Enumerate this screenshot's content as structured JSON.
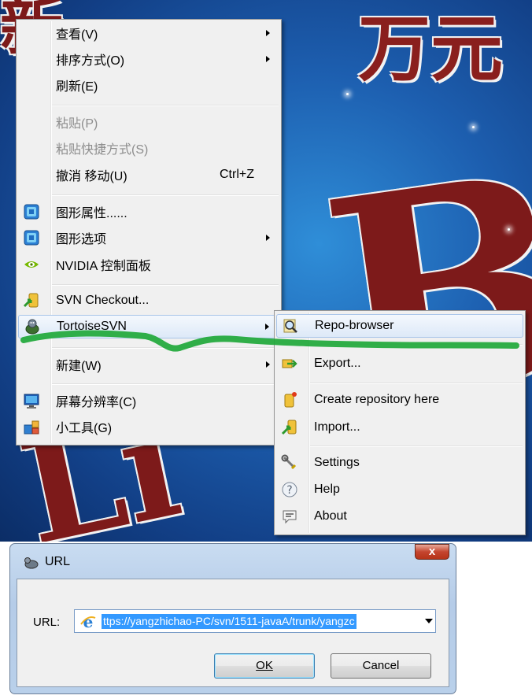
{
  "context_menu": {
    "items": [
      {
        "label": "查看(V)",
        "submenu": true
      },
      {
        "label": "排序方式(O)",
        "submenu": true
      },
      {
        "label": "刷新(E)"
      },
      {
        "label": "粘贴(P)",
        "disabled": true
      },
      {
        "label": "粘贴快捷方式(S)",
        "disabled": true
      },
      {
        "label": "撤消 移动(U)",
        "shortcut": "Ctrl+Z"
      },
      {
        "label": "图形属性......",
        "icon": "intel-graphics-icon"
      },
      {
        "label": "图形选项",
        "icon": "intel-graphics-icon",
        "submenu": true
      },
      {
        "label": "NVIDIA 控制面板",
        "icon": "nvidia-icon"
      },
      {
        "label": "SVN Checkout...",
        "icon": "svn-checkout-icon"
      },
      {
        "label": "TortoiseSVN",
        "icon": "tortoisesvn-icon",
        "submenu": true,
        "highlighted": true
      },
      {
        "label": "新建(W)",
        "submenu": true
      },
      {
        "label": "屏幕分辨率(C)",
        "icon": "screen-resolution-icon"
      },
      {
        "label": "小工具(G)",
        "icon": "gadgets-icon"
      }
    ]
  },
  "tortoise_submenu": {
    "items": [
      {
        "label": "Repo-browser",
        "icon": "repo-browser-icon",
        "highlighted": true
      },
      {
        "label": "Export...",
        "icon": "export-icon"
      },
      {
        "label": "Create repository here",
        "icon": "create-repository-icon"
      },
      {
        "label": "Import...",
        "icon": "import-icon"
      },
      {
        "label": "Settings",
        "icon": "settings-icon"
      },
      {
        "label": "Help",
        "icon": "help-icon"
      },
      {
        "label": "About",
        "icon": "about-icon"
      }
    ]
  },
  "dialog": {
    "title": "URL",
    "close_label": "x",
    "url_label": "URL:",
    "url_value": "ttps://yangzhichao-PC/svn/1511-javaA/trunk/yangzc",
    "ok_label": "OK",
    "cancel_label": "Cancel"
  },
  "colors": {
    "menu_bg": "#f0f0f0",
    "highlight": "#dde9f8",
    "annotation_stroke": "#1fa83a",
    "selection": "#3399ff"
  }
}
